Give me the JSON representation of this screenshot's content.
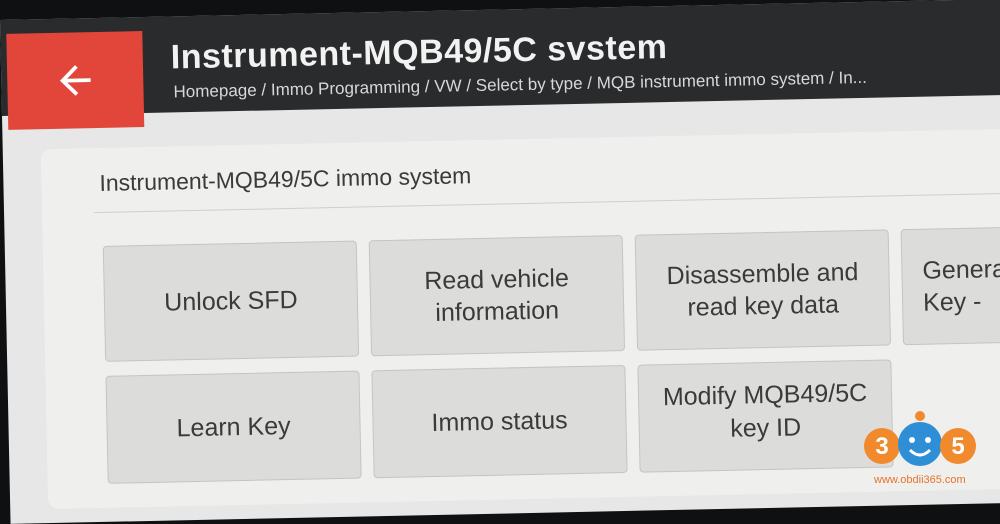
{
  "header": {
    "title": "Instrument-MQB49/5C svstem",
    "breadcrumb": "Homepage / Immo Programming / VW / Select by type / MQB instrument immo system / In..."
  },
  "panel": {
    "section_title": "Instrument-MQB49/5C immo system",
    "tiles": [
      {
        "label": "Unlock SFD"
      },
      {
        "label": "Read vehicle information"
      },
      {
        "label": "Disassemble and read key data"
      },
      {
        "label": "Genera Key -"
      },
      {
        "label": "Learn Key"
      },
      {
        "label": "Immo status"
      },
      {
        "label": "Modify MQB49/5C key ID"
      }
    ]
  },
  "watermark": {
    "logo": "365",
    "url": "www.obdii365.com"
  },
  "colors": {
    "accent": "#e2463a",
    "header_bg": "#2a2b2d",
    "tile_bg": "#dcdcdb"
  }
}
